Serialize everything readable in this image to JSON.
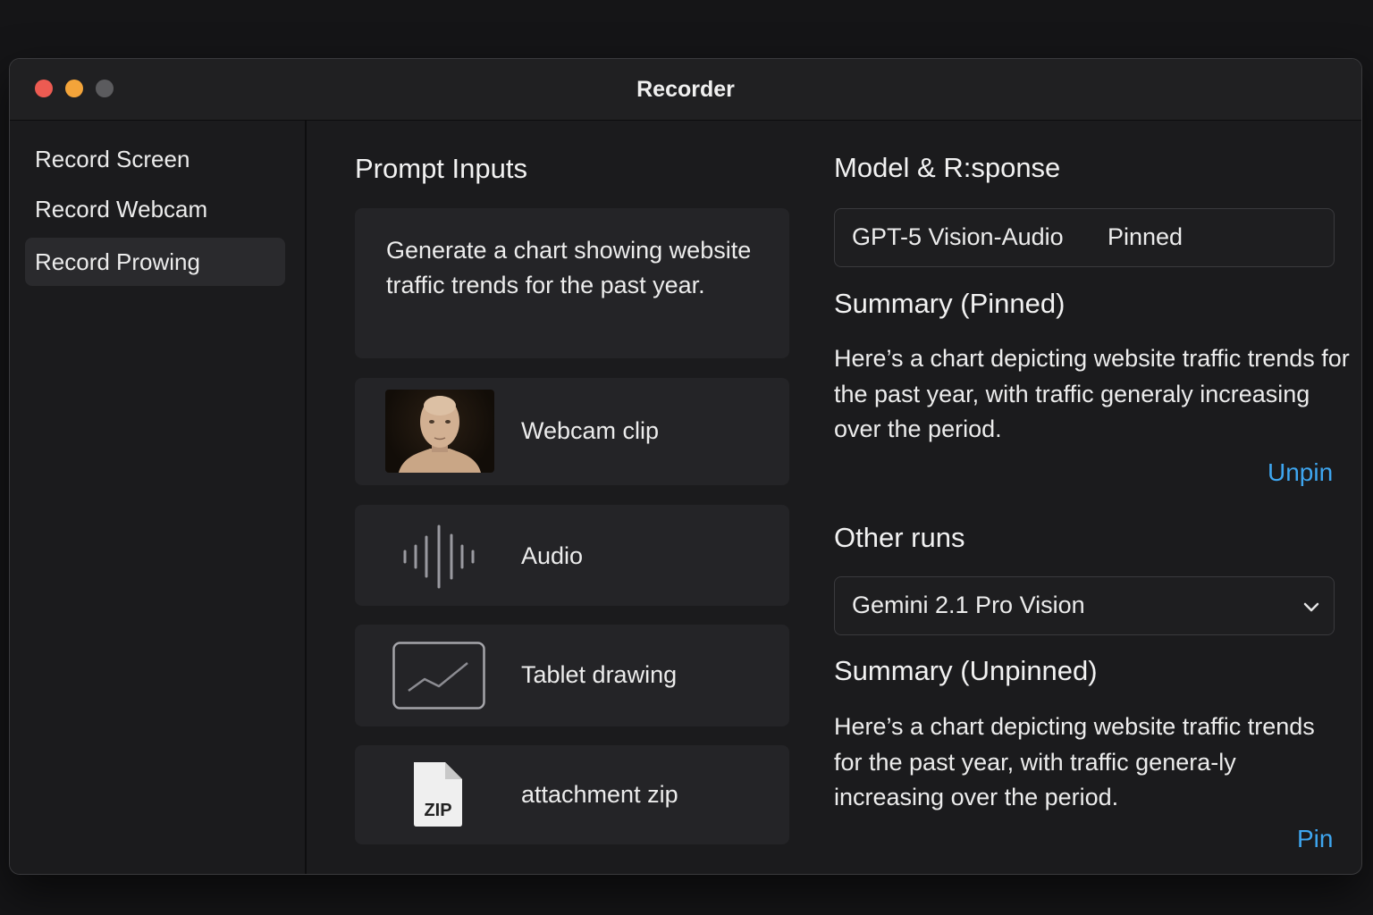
{
  "window": {
    "title": "Recorder"
  },
  "sidebar": {
    "items": [
      {
        "label": "Record Screen"
      },
      {
        "label": "Record Webcam"
      },
      {
        "label": "Record Prowing",
        "active": true
      }
    ]
  },
  "prompt_inputs": {
    "title": "Prompt Inputs",
    "prompt_text": "Generate a chart showing website traffic trends for the past year.",
    "items": [
      {
        "label": "Webcam clip",
        "icon": "webcam-thumbnail"
      },
      {
        "label": "Audio",
        "icon": "audio-waveform-icon"
      },
      {
        "label": "Tablet drawing",
        "icon": "tablet-drawing-icon"
      },
      {
        "label": "attachment zip",
        "icon": "zip-file-icon",
        "icon_text": "ZIP"
      }
    ]
  },
  "response": {
    "title": "Model & R:sponse",
    "model_name": "GPT-5 Vision-Audio",
    "pinned_label": "Pinned",
    "summary_title": "Summary (Pinned)",
    "summary_text": "Here’s a chart depicting website traffic trends for the past year, with traffic generaly increasing over the period.",
    "unpin_label": "Unpin"
  },
  "other_runs": {
    "title": "Other runs",
    "selected_model": "Gemini 2.1 Pro Vision",
    "summary_title": "Summary (Unpinned)",
    "summary_text": "Here’s a chart depicting website traffic trends for the past year, with traffic genera-ly increasing over the period.",
    "pin_label": "Pin"
  },
  "colors": {
    "background": "#151517",
    "window": "#1b1b1d",
    "card": "#242427",
    "link": "#3ea6f0",
    "close": "#ed5b52",
    "minimize": "#f3a43a"
  }
}
